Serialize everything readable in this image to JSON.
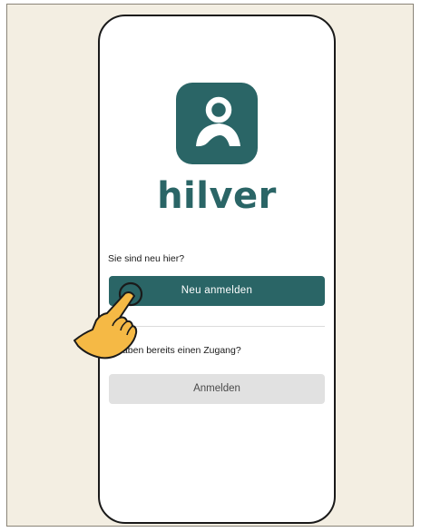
{
  "app": {
    "brand_name": "hilver",
    "logo_icon": "person-icon"
  },
  "new_user": {
    "question": "Sie sind neu hier?",
    "button_label": "Neu anmelden"
  },
  "existing_user": {
    "question": "Sie haben bereits einen Zugang?",
    "button_label": "Anmelden"
  },
  "overlay": {
    "pointer_icon": "tap-hand-icon"
  },
  "colors": {
    "brand": "#2a6566",
    "background": "#f3eee2",
    "secondary_button": "#e1e1e1",
    "hand": "#f5b945"
  }
}
